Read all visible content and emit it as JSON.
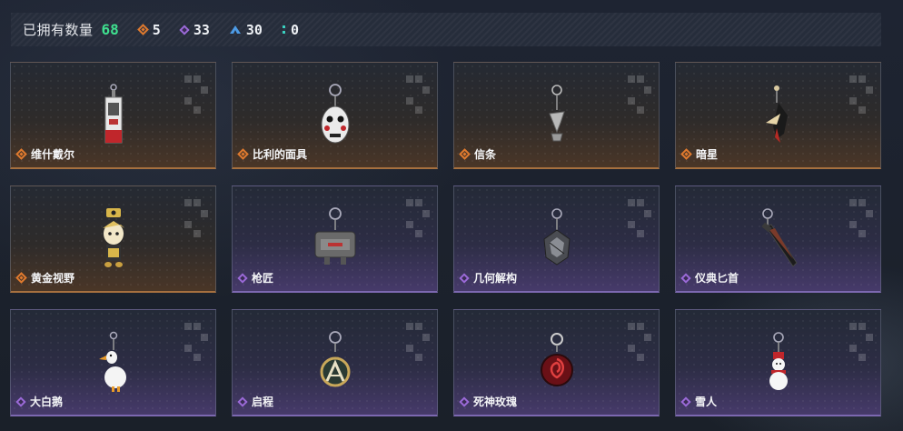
{
  "stats": {
    "label": "已拥有数量",
    "total": "68",
    "orange_count": "5",
    "purple_count": "33",
    "blue_count": "30",
    "teal_count": "0"
  },
  "colors": {
    "total": "#3fe08f",
    "orange": "#e07a2e",
    "purple": "#9b6ad8",
    "blue": "#4d9be6",
    "teal": "#3ad0c0"
  },
  "items": [
    {
      "name": "维什戴尔",
      "rarity": "orange",
      "icon": "vishdel-charm-icon"
    },
    {
      "name": "比利的面具",
      "rarity": "orange",
      "icon": "billy-mask-charm-icon"
    },
    {
      "name": "信条",
      "rarity": "orange",
      "icon": "creed-charm-icon"
    },
    {
      "name": "暗星",
      "rarity": "orange",
      "icon": "dark-star-charm-icon"
    },
    {
      "name": "黄金视野",
      "rarity": "orange",
      "icon": "golden-vision-charm-icon"
    },
    {
      "name": "枪匠",
      "rarity": "purple",
      "icon": "gunsmith-charm-icon"
    },
    {
      "name": "几何解构",
      "rarity": "purple",
      "icon": "geometric-charm-icon"
    },
    {
      "name": "仪典匕首",
      "rarity": "purple",
      "icon": "ritual-dagger-charm-icon"
    },
    {
      "name": "大白鹅",
      "rarity": "purple",
      "icon": "white-goose-charm-icon"
    },
    {
      "name": "启程",
      "rarity": "purple",
      "icon": "departure-charm-icon"
    },
    {
      "name": "死神玫瑰",
      "rarity": "purple",
      "icon": "death-rose-charm-icon"
    },
    {
      "name": "雪人",
      "rarity": "purple",
      "icon": "snowman-charm-icon"
    }
  ]
}
